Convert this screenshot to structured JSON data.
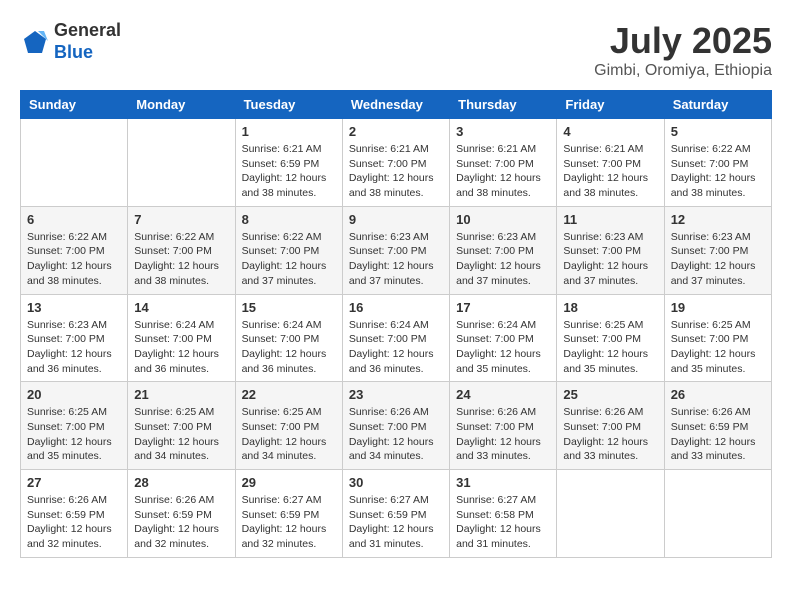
{
  "logo": {
    "general": "General",
    "blue": "Blue"
  },
  "header": {
    "month": "July 2025",
    "location": "Gimbi, Oromiya, Ethiopia"
  },
  "weekdays": [
    "Sunday",
    "Monday",
    "Tuesday",
    "Wednesday",
    "Thursday",
    "Friday",
    "Saturday"
  ],
  "weeks": [
    [
      null,
      null,
      {
        "day": 1,
        "sunrise": "6:21 AM",
        "sunset": "6:59 PM",
        "daylight": "12 hours and 38 minutes."
      },
      {
        "day": 2,
        "sunrise": "6:21 AM",
        "sunset": "7:00 PM",
        "daylight": "12 hours and 38 minutes."
      },
      {
        "day": 3,
        "sunrise": "6:21 AM",
        "sunset": "7:00 PM",
        "daylight": "12 hours and 38 minutes."
      },
      {
        "day": 4,
        "sunrise": "6:21 AM",
        "sunset": "7:00 PM",
        "daylight": "12 hours and 38 minutes."
      },
      {
        "day": 5,
        "sunrise": "6:22 AM",
        "sunset": "7:00 PM",
        "daylight": "12 hours and 38 minutes."
      }
    ],
    [
      {
        "day": 6,
        "sunrise": "6:22 AM",
        "sunset": "7:00 PM",
        "daylight": "12 hours and 38 minutes."
      },
      {
        "day": 7,
        "sunrise": "6:22 AM",
        "sunset": "7:00 PM",
        "daylight": "12 hours and 38 minutes."
      },
      {
        "day": 8,
        "sunrise": "6:22 AM",
        "sunset": "7:00 PM",
        "daylight": "12 hours and 37 minutes."
      },
      {
        "day": 9,
        "sunrise": "6:23 AM",
        "sunset": "7:00 PM",
        "daylight": "12 hours and 37 minutes."
      },
      {
        "day": 10,
        "sunrise": "6:23 AM",
        "sunset": "7:00 PM",
        "daylight": "12 hours and 37 minutes."
      },
      {
        "day": 11,
        "sunrise": "6:23 AM",
        "sunset": "7:00 PM",
        "daylight": "12 hours and 37 minutes."
      },
      {
        "day": 12,
        "sunrise": "6:23 AM",
        "sunset": "7:00 PM",
        "daylight": "12 hours and 37 minutes."
      }
    ],
    [
      {
        "day": 13,
        "sunrise": "6:23 AM",
        "sunset": "7:00 PM",
        "daylight": "12 hours and 36 minutes."
      },
      {
        "day": 14,
        "sunrise": "6:24 AM",
        "sunset": "7:00 PM",
        "daylight": "12 hours and 36 minutes."
      },
      {
        "day": 15,
        "sunrise": "6:24 AM",
        "sunset": "7:00 PM",
        "daylight": "12 hours and 36 minutes."
      },
      {
        "day": 16,
        "sunrise": "6:24 AM",
        "sunset": "7:00 PM",
        "daylight": "12 hours and 36 minutes."
      },
      {
        "day": 17,
        "sunrise": "6:24 AM",
        "sunset": "7:00 PM",
        "daylight": "12 hours and 35 minutes."
      },
      {
        "day": 18,
        "sunrise": "6:25 AM",
        "sunset": "7:00 PM",
        "daylight": "12 hours and 35 minutes."
      },
      {
        "day": 19,
        "sunrise": "6:25 AM",
        "sunset": "7:00 PM",
        "daylight": "12 hours and 35 minutes."
      }
    ],
    [
      {
        "day": 20,
        "sunrise": "6:25 AM",
        "sunset": "7:00 PM",
        "daylight": "12 hours and 35 minutes."
      },
      {
        "day": 21,
        "sunrise": "6:25 AM",
        "sunset": "7:00 PM",
        "daylight": "12 hours and 34 minutes."
      },
      {
        "day": 22,
        "sunrise": "6:25 AM",
        "sunset": "7:00 PM",
        "daylight": "12 hours and 34 minutes."
      },
      {
        "day": 23,
        "sunrise": "6:26 AM",
        "sunset": "7:00 PM",
        "daylight": "12 hours and 34 minutes."
      },
      {
        "day": 24,
        "sunrise": "6:26 AM",
        "sunset": "7:00 PM",
        "daylight": "12 hours and 33 minutes."
      },
      {
        "day": 25,
        "sunrise": "6:26 AM",
        "sunset": "7:00 PM",
        "daylight": "12 hours and 33 minutes."
      },
      {
        "day": 26,
        "sunrise": "6:26 AM",
        "sunset": "6:59 PM",
        "daylight": "12 hours and 33 minutes."
      }
    ],
    [
      {
        "day": 27,
        "sunrise": "6:26 AM",
        "sunset": "6:59 PM",
        "daylight": "12 hours and 32 minutes."
      },
      {
        "day": 28,
        "sunrise": "6:26 AM",
        "sunset": "6:59 PM",
        "daylight": "12 hours and 32 minutes."
      },
      {
        "day": 29,
        "sunrise": "6:27 AM",
        "sunset": "6:59 PM",
        "daylight": "12 hours and 32 minutes."
      },
      {
        "day": 30,
        "sunrise": "6:27 AM",
        "sunset": "6:59 PM",
        "daylight": "12 hours and 31 minutes."
      },
      {
        "day": 31,
        "sunrise": "6:27 AM",
        "sunset": "6:58 PM",
        "daylight": "12 hours and 31 minutes."
      },
      null,
      null
    ]
  ]
}
